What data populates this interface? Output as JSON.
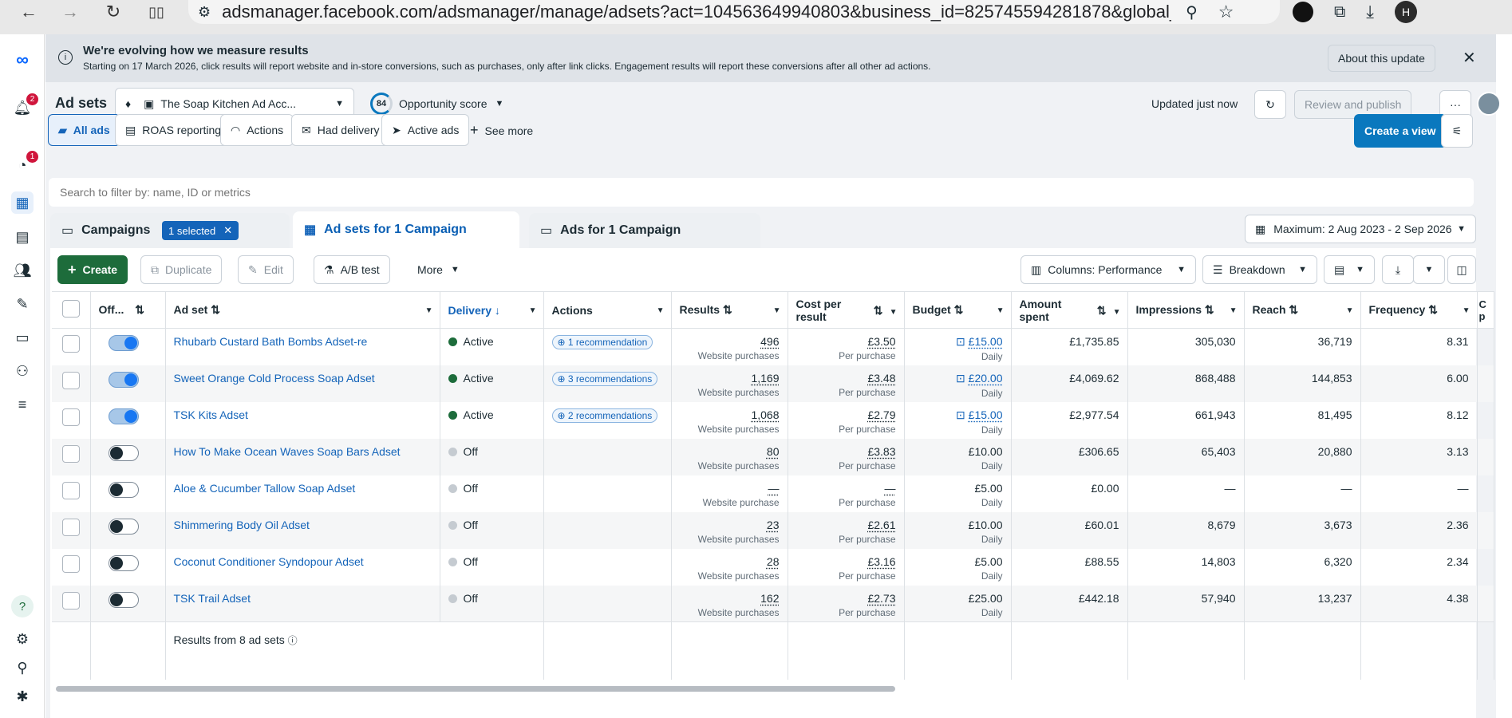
{
  "browser": {
    "url": "adsmanager.facebook.com/adsmanager/manage/adsets?act=104563649940803&business_id=825745594281878&global_scop...",
    "profile_initial": "H"
  },
  "left_nav": {
    "notifications_badge": "2",
    "alerts_badge": "1",
    "help_label": "?"
  },
  "banner": {
    "title": "We're evolving how we measure results",
    "body": "Starting on 17 March 2026, click results will report website and in-store conversions, such as purchases, only after link clicks. Engagement results will report these conversions after all other ad actions.",
    "about_button": "About this update"
  },
  "header": {
    "page_title": "Ad sets",
    "account_name": "The Soap Kitchen Ad Acc...",
    "opportunity_score": "84",
    "opportunity_label": "Opportunity score",
    "updated_text": "Updated just now",
    "review_publish": "Review and publish",
    "more_dots": "···"
  },
  "view_tabs": {
    "items": [
      "All ads",
      "ROAS reporting",
      "Actions",
      "Had delivery",
      "Active ads"
    ],
    "see_more": "See more",
    "create_view": "Create a view"
  },
  "search": {
    "placeholder": "Search to filter by: name, ID or metrics"
  },
  "level_tabs": {
    "campaigns": "Campaigns",
    "selected_chip": "1 selected",
    "adsets": "Ad sets for 1 Campaign",
    "ads": "Ads for 1 Campaign",
    "date_range": "Maximum: 2 Aug 2023 - 2 Sep 2026"
  },
  "toolbar": {
    "create": "Create",
    "duplicate": "Duplicate",
    "edit": "Edit",
    "ab_test": "A/B test",
    "more": "More",
    "columns": "Columns: Performance",
    "breakdown": "Breakdown"
  },
  "table": {
    "headers": {
      "off_on": "Off...",
      "adset": "Ad set",
      "delivery": "Delivery",
      "actions": "Actions",
      "results": "Results",
      "cost_per_result": "Cost per result",
      "budget": "Budget",
      "amount_spent": "Amount spent",
      "impressions": "Impressions",
      "reach": "Reach",
      "frequency": "Frequency",
      "clipped": "C p"
    },
    "rows": [
      {
        "name": "Rhubarb Custard Bath Bombs Adset-re",
        "on": true,
        "delivery": "Active",
        "rec": "1 recommendation",
        "results": "496",
        "results_sub": "Website purchases",
        "cpr": "£3.50",
        "cpr_sub": "Per purchase",
        "budget": "£15.00",
        "budget_sub": "Daily",
        "budget_link": true,
        "spent": "£1,735.85",
        "impr": "305,030",
        "reach": "36,719",
        "freq": "8.31"
      },
      {
        "name": "Sweet Orange Cold Process Soap Adset",
        "on": true,
        "delivery": "Active",
        "rec": "3 recommendations",
        "results": "1,169",
        "results_sub": "Website purchases",
        "cpr": "£3.48",
        "cpr_sub": "Per purchase",
        "budget": "£20.00",
        "budget_sub": "Daily",
        "budget_link": true,
        "spent": "£4,069.62",
        "impr": "868,488",
        "reach": "144,853",
        "freq": "6.00"
      },
      {
        "name": "TSK Kits Adset",
        "on": true,
        "delivery": "Active",
        "rec": "2 recommendations",
        "results": "1,068",
        "results_sub": "Website purchases",
        "cpr": "£2.79",
        "cpr_sub": "Per purchase",
        "budget": "£15.00",
        "budget_sub": "Daily",
        "budget_link": true,
        "spent": "£2,977.54",
        "impr": "661,943",
        "reach": "81,495",
        "freq": "8.12"
      },
      {
        "name": "How To Make Ocean Waves Soap Bars Adset",
        "on": false,
        "delivery": "Off",
        "rec": "",
        "results": "80",
        "results_sub": "Website purchases",
        "cpr": "£3.83",
        "cpr_sub": "Per purchase",
        "budget": "£10.00",
        "budget_sub": "Daily",
        "budget_link": false,
        "spent": "£306.65",
        "impr": "65,403",
        "reach": "20,880",
        "freq": "3.13"
      },
      {
        "name": "Aloe & Cucumber Tallow Soap Adset",
        "on": false,
        "delivery": "Off",
        "rec": "",
        "results": "—",
        "results_sub": "Website purchase",
        "cpr": "—",
        "cpr_sub": "Per purchase",
        "budget": "£5.00",
        "budget_sub": "Daily",
        "budget_link": false,
        "spent": "£0.00",
        "impr": "—",
        "reach": "—",
        "freq": "—"
      },
      {
        "name": "Shimmering Body Oil Adset",
        "on": false,
        "delivery": "Off",
        "rec": "",
        "results": "23",
        "results_sub": "Website purchases",
        "cpr": "£2.61",
        "cpr_sub": "Per purchase",
        "budget": "£10.00",
        "budget_sub": "Daily",
        "budget_link": false,
        "spent": "£60.01",
        "impr": "8,679",
        "reach": "3,673",
        "freq": "2.36"
      },
      {
        "name": "Coconut Conditioner Syndopour Adset",
        "on": false,
        "delivery": "Off",
        "rec": "",
        "results": "28",
        "results_sub": "Website purchases",
        "cpr": "£3.16",
        "cpr_sub": "Per purchase",
        "budget": "£5.00",
        "budget_sub": "Daily",
        "budget_link": false,
        "spent": "£88.55",
        "impr": "14,803",
        "reach": "6,320",
        "freq": "2.34"
      },
      {
        "name": "TSK Trail Adset",
        "on": false,
        "delivery": "Off",
        "rec": "",
        "results": "162",
        "results_sub": "Website purchases",
        "cpr": "£2.73",
        "cpr_sub": "Per purchase",
        "budget": "£25.00",
        "budget_sub": "Daily",
        "budget_link": false,
        "spent": "£442.18",
        "impr": "57,940",
        "reach": "13,237",
        "freq": "4.38"
      }
    ],
    "summary": "Results from 8 ad sets"
  },
  "colors": {
    "active_dot": "#1d6c3b",
    "off_dot": "#c5cbd1",
    "link": "#1464b9",
    "primary": "#0a78be",
    "create": "#1d6c3b"
  }
}
